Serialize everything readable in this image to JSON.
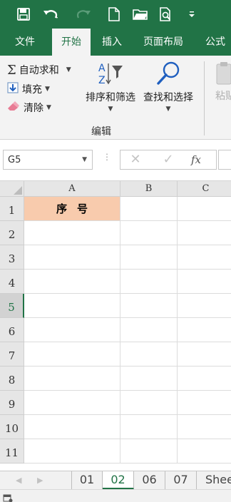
{
  "quick_access": {
    "icons": [
      "save-icon",
      "undo-icon",
      "redo-icon",
      "new-file-icon",
      "open-folder-icon",
      "print-preview-icon",
      "customize-toolbar-icon"
    ]
  },
  "ribbon_tabs": [
    {
      "label": "文件",
      "active": false
    },
    {
      "label": "开始",
      "active": true
    },
    {
      "label": "插入",
      "active": false
    },
    {
      "label": "页面布局",
      "active": false
    },
    {
      "label": "公式",
      "active": false
    }
  ],
  "ribbon": {
    "autosum": "自动求和",
    "fill": "填充",
    "clear": "清除",
    "sort_filter": "排序和筛选",
    "find_select": "查找和选择",
    "group_label": "编辑",
    "paste": "粘贴"
  },
  "formula_bar": {
    "name_box": "G5",
    "fx_label": "fx",
    "formula": ""
  },
  "grid": {
    "columns": [
      "A",
      "B",
      "C"
    ],
    "rows": [
      "1",
      "2",
      "3",
      "4",
      "5",
      "6",
      "7",
      "8",
      "9",
      "10",
      "11"
    ],
    "active_row": "5",
    "cells": {
      "A1": "序号"
    },
    "header_fill": "#f8cbad"
  },
  "sheet_tabs": [
    {
      "label": "01",
      "active": false
    },
    {
      "label": "02",
      "active": true
    },
    {
      "label": "06",
      "active": false
    },
    {
      "label": "07",
      "active": false
    },
    {
      "label": "Shee",
      "active": false
    }
  ],
  "colors": {
    "accent": "#217346",
    "header_fill": "#f8cbad"
  }
}
